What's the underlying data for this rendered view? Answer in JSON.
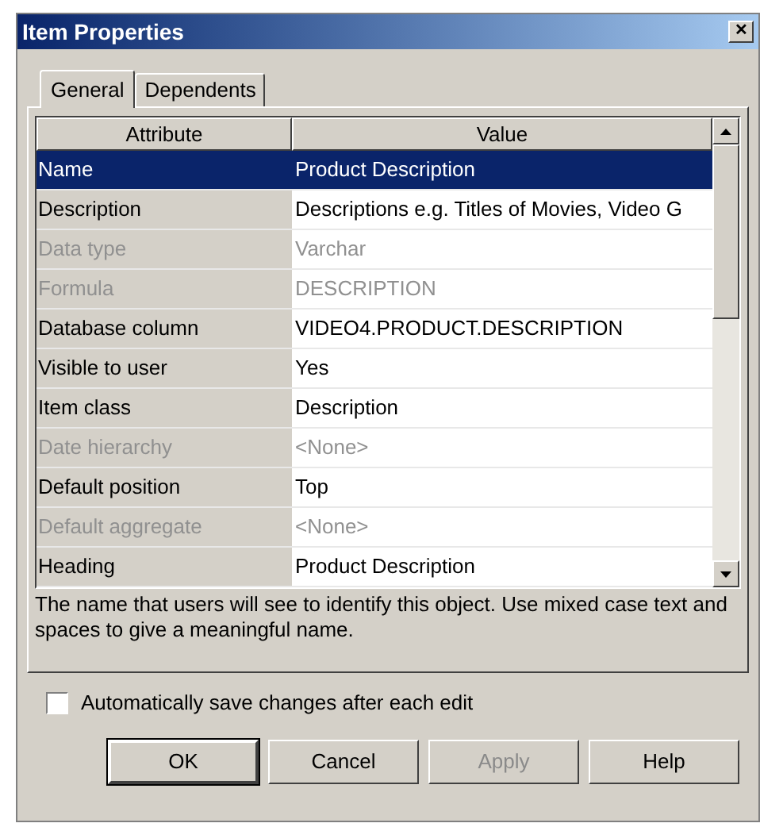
{
  "window": {
    "title": "Item Properties",
    "close": "✕"
  },
  "tabs": [
    {
      "label": "General",
      "selected": true
    },
    {
      "label": "Dependents",
      "selected": false
    }
  ],
  "table": {
    "columns": [
      "Attribute",
      "Value"
    ],
    "rows": [
      {
        "attribute": "Name",
        "value": "Product Description",
        "disabled": false,
        "selected": true
      },
      {
        "attribute": "Description",
        "value": "Descriptions e.g. Titles of Movies, Video G",
        "disabled": false,
        "selected": false
      },
      {
        "attribute": "Data type",
        "value": "Varchar",
        "disabled": true,
        "selected": false
      },
      {
        "attribute": "Formula",
        "value": "DESCRIPTION",
        "disabled": true,
        "selected": false
      },
      {
        "attribute": "Database column",
        "value": "VIDEO4.PRODUCT.DESCRIPTION",
        "disabled": false,
        "selected": false
      },
      {
        "attribute": "Visible to user",
        "value": "Yes",
        "disabled": false,
        "selected": false
      },
      {
        "attribute": "Item class",
        "value": "Description",
        "disabled": false,
        "selected": false
      },
      {
        "attribute": "Date hierarchy",
        "value": "<None>",
        "disabled": true,
        "selected": false
      },
      {
        "attribute": "Default position",
        "value": "Top",
        "disabled": false,
        "selected": false
      },
      {
        "attribute": "Default aggregate",
        "value": "<None>",
        "disabled": true,
        "selected": false
      },
      {
        "attribute": "Heading",
        "value": "Product Description",
        "disabled": false,
        "selected": false
      }
    ]
  },
  "description": "The name that users will see to identify this object. Use mixed case text and spaces to give a meaningful name.",
  "auto_save": {
    "label": "Automatically save changes after each edit",
    "checked": false
  },
  "buttons": [
    {
      "label": "OK",
      "disabled": false,
      "default": true
    },
    {
      "label": "Cancel",
      "disabled": false,
      "default": false
    },
    {
      "label": "Apply",
      "disabled": true,
      "default": false
    },
    {
      "label": "Help",
      "disabled": false,
      "default": false
    }
  ]
}
